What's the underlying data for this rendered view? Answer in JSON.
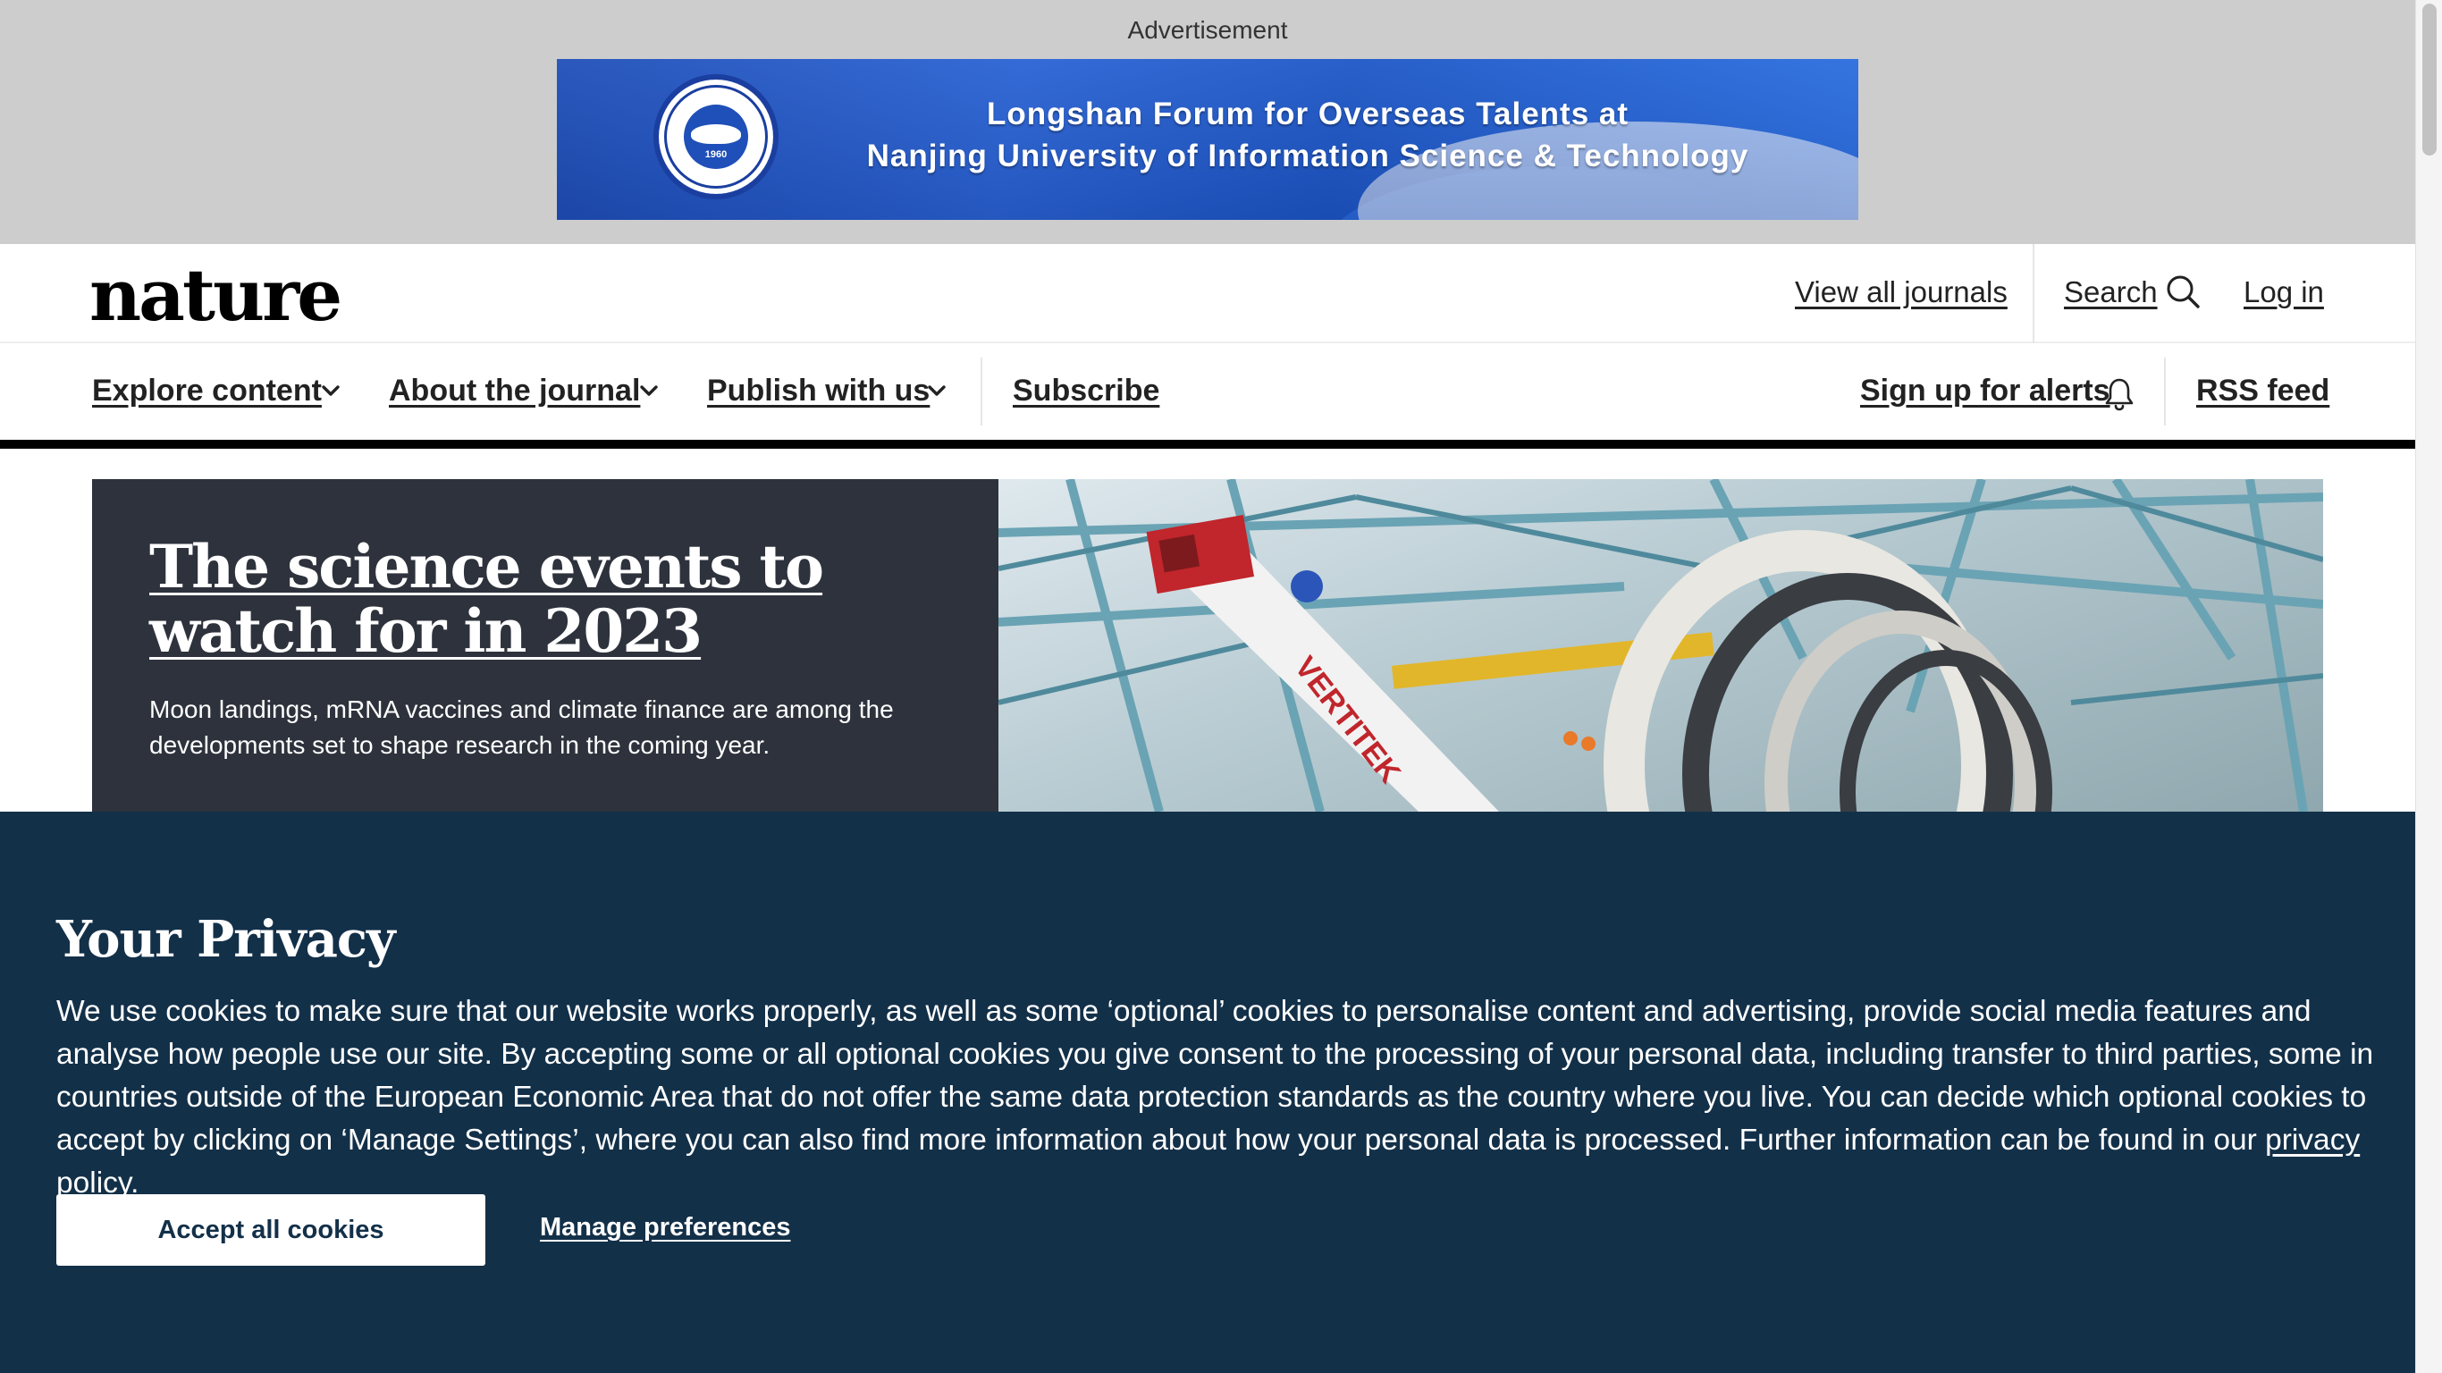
{
  "advertisement": {
    "label": "Advertisement",
    "banner_line1": "Longshan Forum for Overseas Talents at",
    "banner_line2": "Nanjing University of Information Science & Technology",
    "seal_year": "1960"
  },
  "header": {
    "logo": "nature",
    "view_all_journals": "View all journals",
    "search": "Search",
    "login": "Log in"
  },
  "nav": {
    "explore": "Explore content",
    "about": "About the journal",
    "publish": "Publish with us",
    "subscribe": "Subscribe",
    "alerts": "Sign up for alerts",
    "rss": "RSS feed"
  },
  "hero": {
    "title": "The science events to watch for in 2023",
    "subtitle": "Moon landings, mRNA vaccines and climate finance are among the developments set to shape research in the coming year.",
    "image_lift_text": "VERTITEK"
  },
  "privacy": {
    "title": "Your Privacy",
    "body": "We use cookies to make sure that our website works properly, as well as some ‘optional’ cookies to personalise content and advertising, provide social media features and analyse how people use our site. By accepting some or all optional cookies you give consent to the processing of your personal data, including transfer to third parties, some in countries outside of the European Economic Area that do not offer the same data protection standards as the country where you live. You can decide which optional cookies to accept by clicking on ‘Manage Settings’, where you can also find more information about how your personal data is processed. Further information can be found in our ",
    "policy_link": "privacy policy",
    "body_end": ".",
    "accept_button": "Accept all cookies",
    "manage_button": "Manage preferences"
  },
  "colors": {
    "privacy_bg": "#133049",
    "hero_text_bg": "#2d323c",
    "ad_band_bg": "#cdcdcd",
    "ad_banner_blue": "#2a63d4"
  },
  "icons": [
    "search-icon",
    "chevron-down-icon",
    "bell-icon",
    "university-seal-logo"
  ]
}
